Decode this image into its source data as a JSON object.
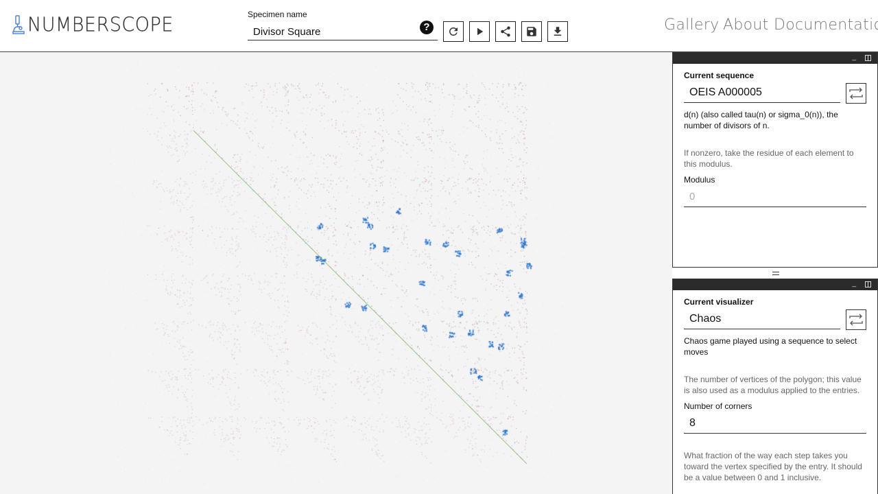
{
  "header": {
    "logo_text": "NUMBERSCOPE",
    "specimen_label": "Specimen name",
    "specimen_value": "Divisor Square",
    "help_icon": "?",
    "tools": [
      "refresh-icon",
      "play-icon",
      "share-icon",
      "save-icon",
      "download-icon"
    ]
  },
  "nav": {
    "gallery": "Gallery",
    "about": "About",
    "documentation": "Documentation"
  },
  "sequence_panel": {
    "label": "Current sequence",
    "value": "OEIS A000005",
    "description": "d(n) (also called tau(n) or sigma_0(n)), the number of divisors of n.",
    "modulus_help": "If nonzero, take the residue of each element to this modulus.",
    "modulus_label": "Modulus",
    "modulus_placeholder": "0"
  },
  "visualizer_panel": {
    "label": "Current visualizer",
    "value": "Chaos",
    "description": "Chaos game played using a sequence to select moves",
    "corners_help": "The number of vertices of the polygon; this value is also used as a modulus applied to the entries.",
    "corners_label": "Number of corners",
    "corners_value": "8",
    "fraction_help": "What fraction of the way each step takes you toward the vertex specified by the entry. It should be a value between 0 and 1 inclusive."
  },
  "colors": {
    "accent": "#4a7fd6",
    "dot_red": "#8a3a32",
    "dot_blue": "#2a73cc",
    "dot_green": "#4a9a3a"
  }
}
